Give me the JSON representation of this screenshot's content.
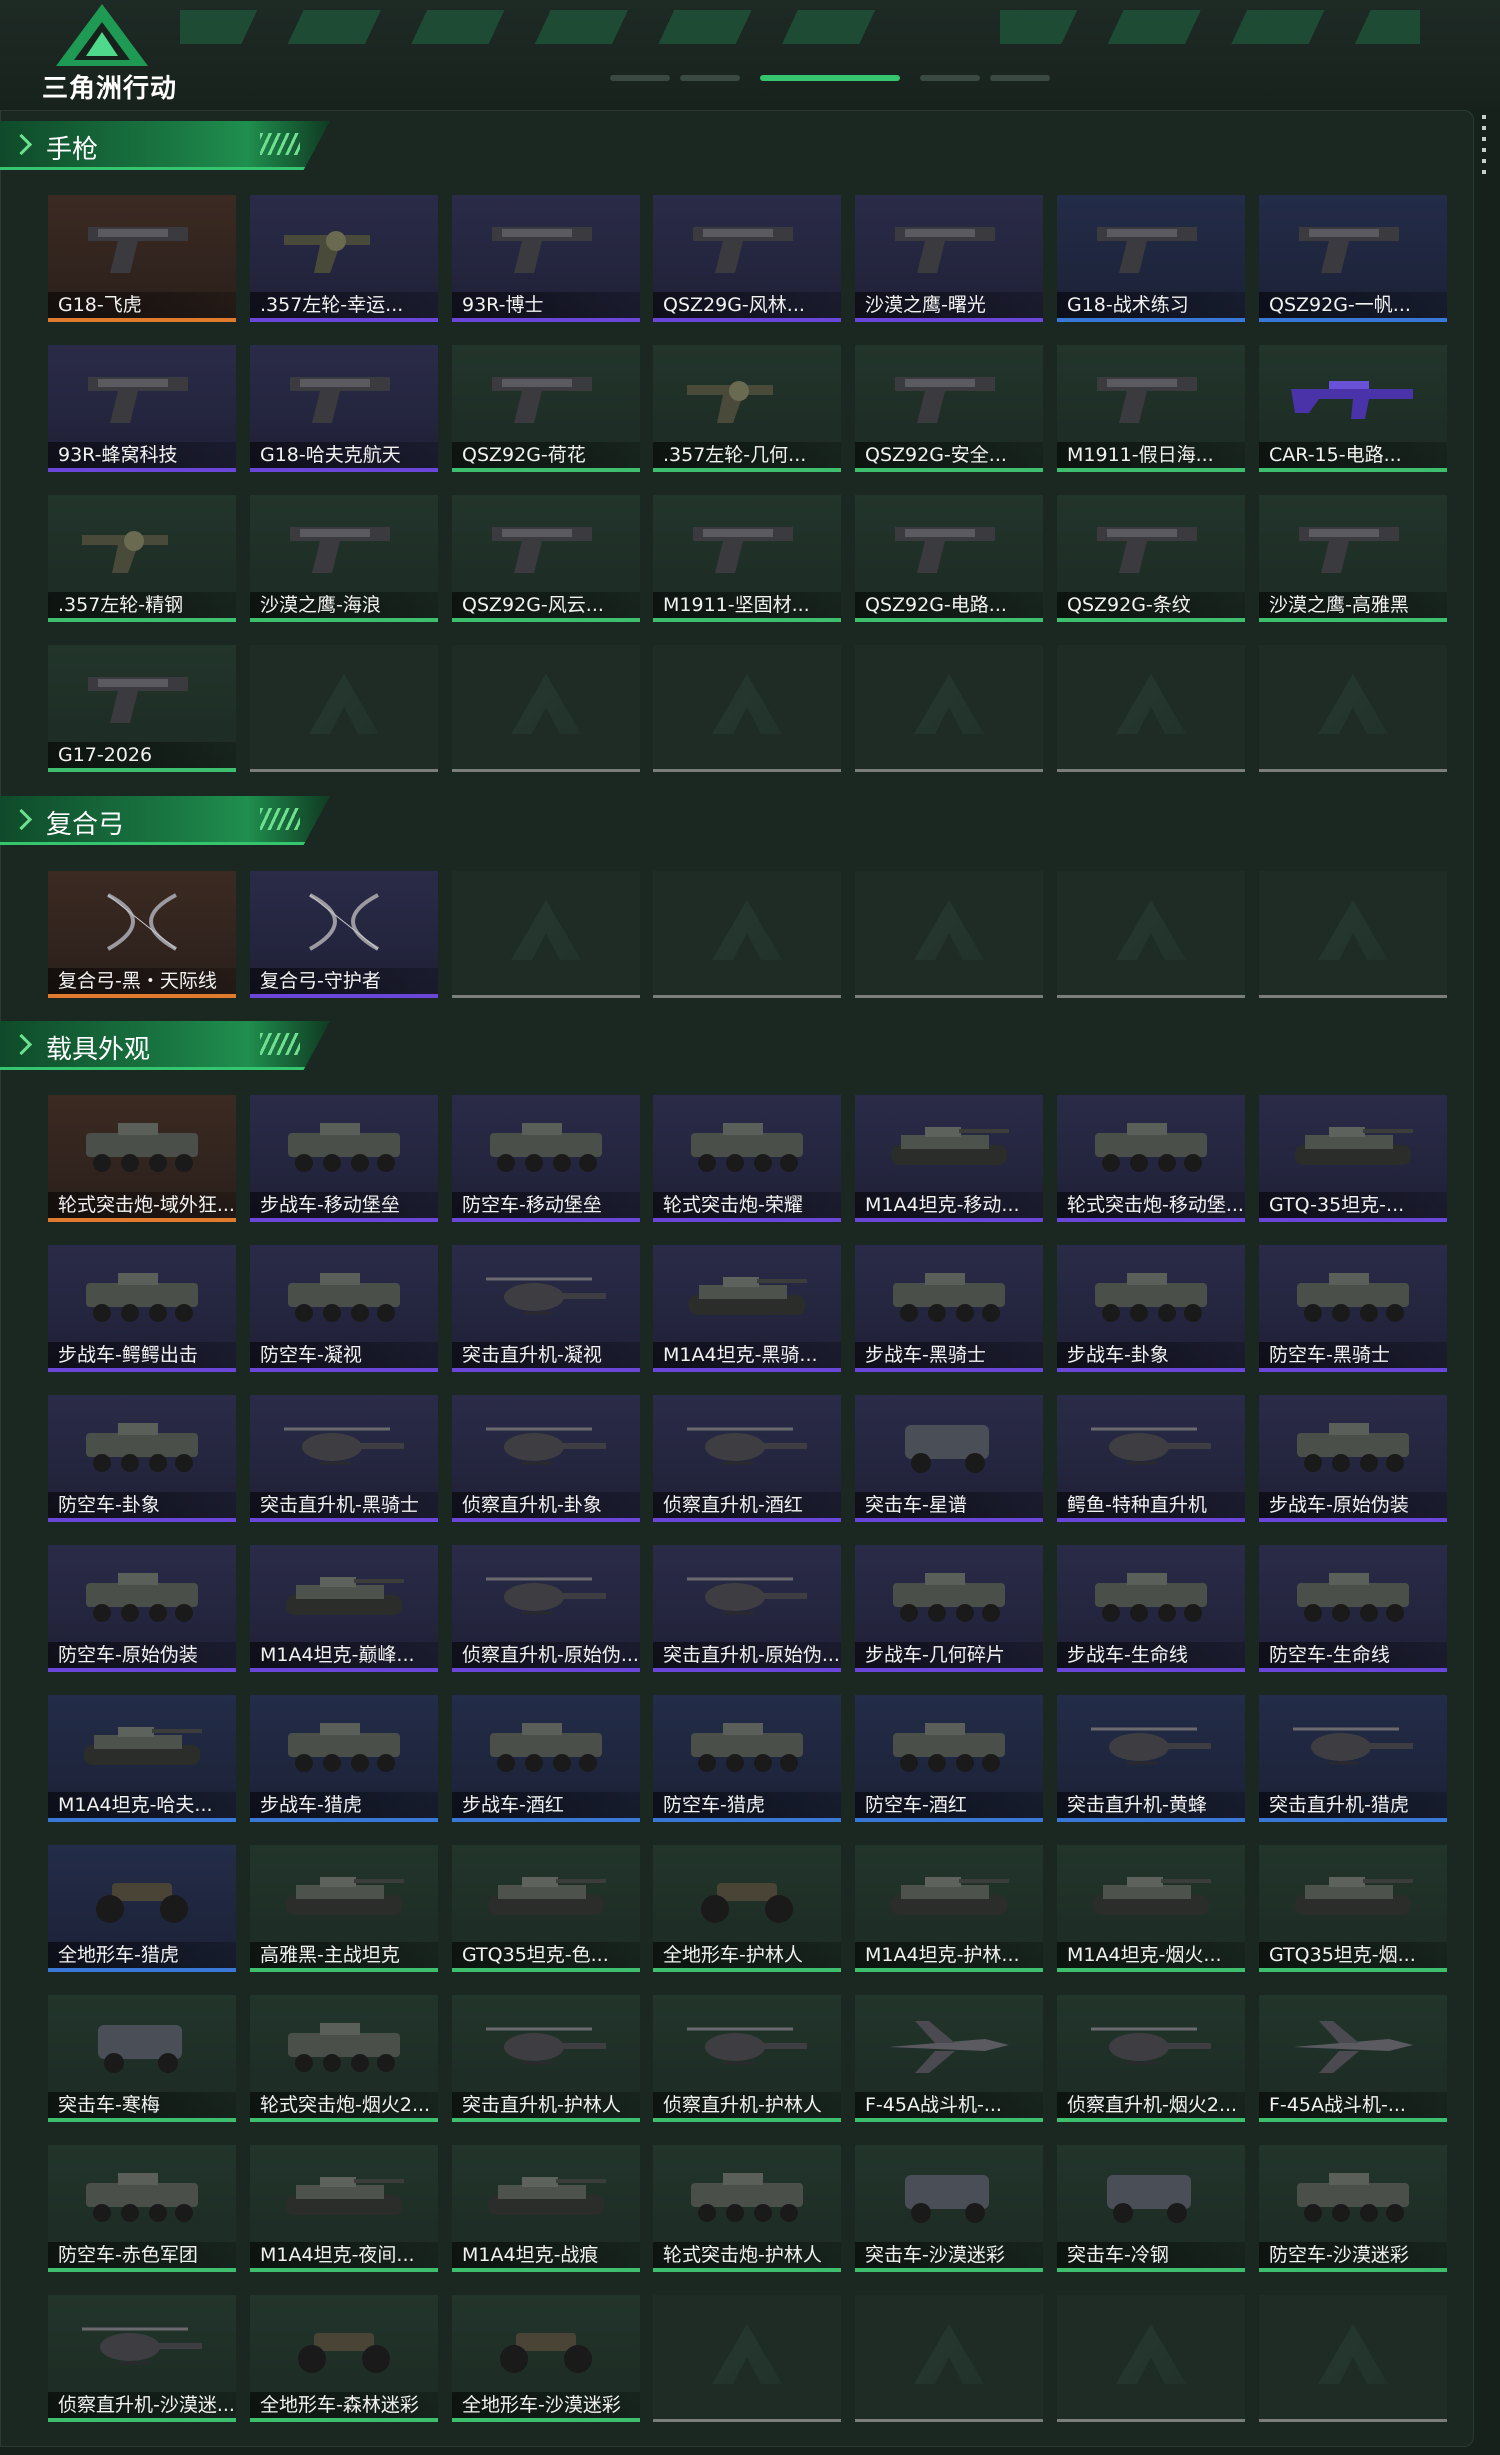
{
  "app": {
    "logo_text": "三角洲行动",
    "colors": {
      "accent": "#35c56e",
      "orange": "#e07a2e",
      "purple": "#6a47d8",
      "blue": "#3a78d8",
      "green": "#3dbf6e"
    }
  },
  "sections": [
    {
      "title": "手枪",
      "items": [
        {
          "name": "G18-飞虎",
          "rarity": "orange",
          "icon": "pistol-icon"
        },
        {
          "name": ".357左轮-幸运...",
          "rarity": "purple",
          "icon": "revolver-icon"
        },
        {
          "name": "93R-博士",
          "rarity": "purple",
          "icon": "pistol-icon"
        },
        {
          "name": "QSZ29G-风林...",
          "rarity": "purple",
          "icon": "pistol-icon"
        },
        {
          "name": "沙漠之鹰-曙光",
          "rarity": "purple",
          "icon": "pistol-icon"
        },
        {
          "name": "G18-战术练习",
          "rarity": "blue",
          "icon": "pistol-icon"
        },
        {
          "name": "QSZ92G-一帆...",
          "rarity": "blue",
          "icon": "pistol-icon"
        },
        {
          "name": "93R-蜂窝科技",
          "rarity": "purple",
          "icon": "pistol-icon"
        },
        {
          "name": "G18-哈夫克航天",
          "rarity": "purple",
          "icon": "pistol-icon"
        },
        {
          "name": "QSZ92G-荷花",
          "rarity": "green",
          "icon": "pistol-icon"
        },
        {
          "name": ".357左轮-几何...",
          "rarity": "green",
          "icon": "revolver-icon"
        },
        {
          "name": "QSZ92G-安全...",
          "rarity": "green",
          "icon": "pistol-icon"
        },
        {
          "name": "M1911-假日海...",
          "rarity": "green",
          "icon": "pistol-icon"
        },
        {
          "name": "CAR-15-电路...",
          "rarity": "green",
          "icon": "rifle-icon"
        },
        {
          "name": ".357左轮-精钢",
          "rarity": "green",
          "icon": "revolver-icon"
        },
        {
          "name": "沙漠之鹰-海浪",
          "rarity": "green",
          "icon": "pistol-icon"
        },
        {
          "name": "QSZ92G-风云...",
          "rarity": "green",
          "icon": "pistol-icon"
        },
        {
          "name": "M1911-坚固材...",
          "rarity": "green",
          "icon": "pistol-icon"
        },
        {
          "name": "QSZ92G-电路...",
          "rarity": "green",
          "icon": "pistol-icon"
        },
        {
          "name": "QSZ92G-条纹",
          "rarity": "green",
          "icon": "pistol-icon"
        },
        {
          "name": "沙漠之鹰-高雅黑",
          "rarity": "green",
          "icon": "pistol-icon"
        },
        {
          "name": "G17-2026",
          "rarity": "green",
          "icon": "pistol-icon"
        }
      ],
      "empty_slots": 6
    },
    {
      "title": "复合弓",
      "items": [
        {
          "name": "复合弓-黑・天际线",
          "rarity": "orange",
          "icon": "bow-icon"
        },
        {
          "name": "复合弓-守护者",
          "rarity": "purple",
          "icon": "bow-icon"
        }
      ],
      "empty_slots": 5
    },
    {
      "title": "载具外观",
      "items": [
        {
          "name": "轮式突击炮-域外狂...",
          "rarity": "orange",
          "icon": "apc-icon"
        },
        {
          "name": "步战车-移动堡垒",
          "rarity": "purple",
          "icon": "apc-icon"
        },
        {
          "name": "防空车-移动堡垒",
          "rarity": "purple",
          "icon": "apc-icon"
        },
        {
          "name": "轮式突击炮-荣耀",
          "rarity": "purple",
          "icon": "apc-icon"
        },
        {
          "name": "M1A4坦克-移动...",
          "rarity": "purple",
          "icon": "tank-icon"
        },
        {
          "name": "轮式突击炮-移动堡...",
          "rarity": "purple",
          "icon": "apc-icon"
        },
        {
          "name": "GTQ-35坦克-...",
          "rarity": "purple",
          "icon": "tank-icon"
        },
        {
          "name": "步战车-鳄鳄出击",
          "rarity": "purple",
          "icon": "apc-icon"
        },
        {
          "name": "防空车-凝视",
          "rarity": "purple",
          "icon": "apc-icon"
        },
        {
          "name": "突击直升机-凝视",
          "rarity": "purple",
          "icon": "helicopter-icon"
        },
        {
          "name": "M1A4坦克-黑骑...",
          "rarity": "purple",
          "icon": "tank-icon"
        },
        {
          "name": "步战车-黑骑士",
          "rarity": "purple",
          "icon": "apc-icon"
        },
        {
          "name": "步战车-卦象",
          "rarity": "purple",
          "icon": "apc-icon"
        },
        {
          "name": "防空车-黑骑士",
          "rarity": "purple",
          "icon": "apc-icon"
        },
        {
          "name": "防空车-卦象",
          "rarity": "purple",
          "icon": "apc-icon"
        },
        {
          "name": "突击直升机-黑骑士",
          "rarity": "purple",
          "icon": "helicopter-icon"
        },
        {
          "name": "侦察直升机-卦象",
          "rarity": "purple",
          "icon": "helicopter-icon"
        },
        {
          "name": "侦察直升机-酒红",
          "rarity": "purple",
          "icon": "helicopter-icon"
        },
        {
          "name": "突击车-星谱",
          "rarity": "purple",
          "icon": "suv-icon"
        },
        {
          "name": "鳄鱼-特种直升机",
          "rarity": "purple",
          "icon": "helicopter-icon"
        },
        {
          "name": "步战车-原始伪装",
          "rarity": "purple",
          "icon": "apc-icon"
        },
        {
          "name": "防空车-原始伪装",
          "rarity": "purple",
          "icon": "apc-icon"
        },
        {
          "name": "M1A4坦克-巅峰...",
          "rarity": "purple",
          "icon": "tank-icon"
        },
        {
          "name": "侦察直升机-原始伪...",
          "rarity": "purple",
          "icon": "helicopter-icon"
        },
        {
          "name": "突击直升机-原始伪...",
          "rarity": "purple",
          "icon": "helicopter-icon"
        },
        {
          "name": "步战车-几何碎片",
          "rarity": "purple",
          "icon": "apc-icon"
        },
        {
          "name": "步战车-生命线",
          "rarity": "purple",
          "icon": "apc-icon"
        },
        {
          "name": "防空车-生命线",
          "rarity": "purple",
          "icon": "apc-icon"
        },
        {
          "name": "M1A4坦克-哈夫...",
          "rarity": "blue",
          "icon": "tank-icon"
        },
        {
          "name": "步战车-猎虎",
          "rarity": "blue",
          "icon": "apc-icon"
        },
        {
          "name": "步战车-酒红",
          "rarity": "blue",
          "icon": "apc-icon"
        },
        {
          "name": "防空车-猎虎",
          "rarity": "blue",
          "icon": "apc-icon"
        },
        {
          "name": "防空车-酒红",
          "rarity": "blue",
          "icon": "apc-icon"
        },
        {
          "name": "突击直升机-黄蜂",
          "rarity": "blue",
          "icon": "helicopter-icon"
        },
        {
          "name": "突击直升机-猎虎",
          "rarity": "blue",
          "icon": "helicopter-icon"
        },
        {
          "name": "全地形车-猎虎",
          "rarity": "blue",
          "icon": "atv-icon"
        },
        {
          "name": "高雅黑-主战坦克",
          "rarity": "green",
          "icon": "tank-icon"
        },
        {
          "name": "GTQ35坦克-色...",
          "rarity": "green",
          "icon": "tank-icon"
        },
        {
          "name": "全地形车-护林人",
          "rarity": "green",
          "icon": "atv-icon"
        },
        {
          "name": "M1A4坦克-护林...",
          "rarity": "green",
          "icon": "tank-icon"
        },
        {
          "name": "M1A4坦克-烟火...",
          "rarity": "green",
          "icon": "tank-icon"
        },
        {
          "name": "GTQ35坦克-烟...",
          "rarity": "green",
          "icon": "tank-icon"
        },
        {
          "name": "突击车-寒梅",
          "rarity": "green",
          "icon": "suv-icon"
        },
        {
          "name": "轮式突击炮-烟火2...",
          "rarity": "green",
          "icon": "apc-icon"
        },
        {
          "name": "突击直升机-护林人",
          "rarity": "green",
          "icon": "helicopter-icon"
        },
        {
          "name": "侦察直升机-护林人",
          "rarity": "green",
          "icon": "helicopter-icon"
        },
        {
          "name": "F-45A战斗机-...",
          "rarity": "green",
          "icon": "jet-icon"
        },
        {
          "name": "侦察直升机-烟火2...",
          "rarity": "green",
          "icon": "helicopter-icon"
        },
        {
          "name": "F-45A战斗机-...",
          "rarity": "green",
          "icon": "jet-icon"
        },
        {
          "name": "防空车-赤色军团",
          "rarity": "green",
          "icon": "apc-icon"
        },
        {
          "name": "M1A4坦克-夜间...",
          "rarity": "green",
          "icon": "tank-icon"
        },
        {
          "name": "M1A4坦克-战痕",
          "rarity": "green",
          "icon": "tank-icon"
        },
        {
          "name": "轮式突击炮-护林人",
          "rarity": "green",
          "icon": "apc-icon"
        },
        {
          "name": "突击车-沙漠迷彩",
          "rarity": "green",
          "icon": "suv-icon"
        },
        {
          "name": "突击车-冷钢",
          "rarity": "green",
          "icon": "suv-icon"
        },
        {
          "name": "防空车-沙漠迷彩",
          "rarity": "green",
          "icon": "apc-icon"
        },
        {
          "name": "侦察直升机-沙漠迷...",
          "rarity": "green",
          "icon": "helicopter-icon"
        },
        {
          "name": "全地形车-森林迷彩",
          "rarity": "green",
          "icon": "atv-icon"
        },
        {
          "name": "全地形车-沙漠迷彩",
          "rarity": "green",
          "icon": "atv-icon"
        }
      ],
      "empty_slots": 4
    }
  ]
}
